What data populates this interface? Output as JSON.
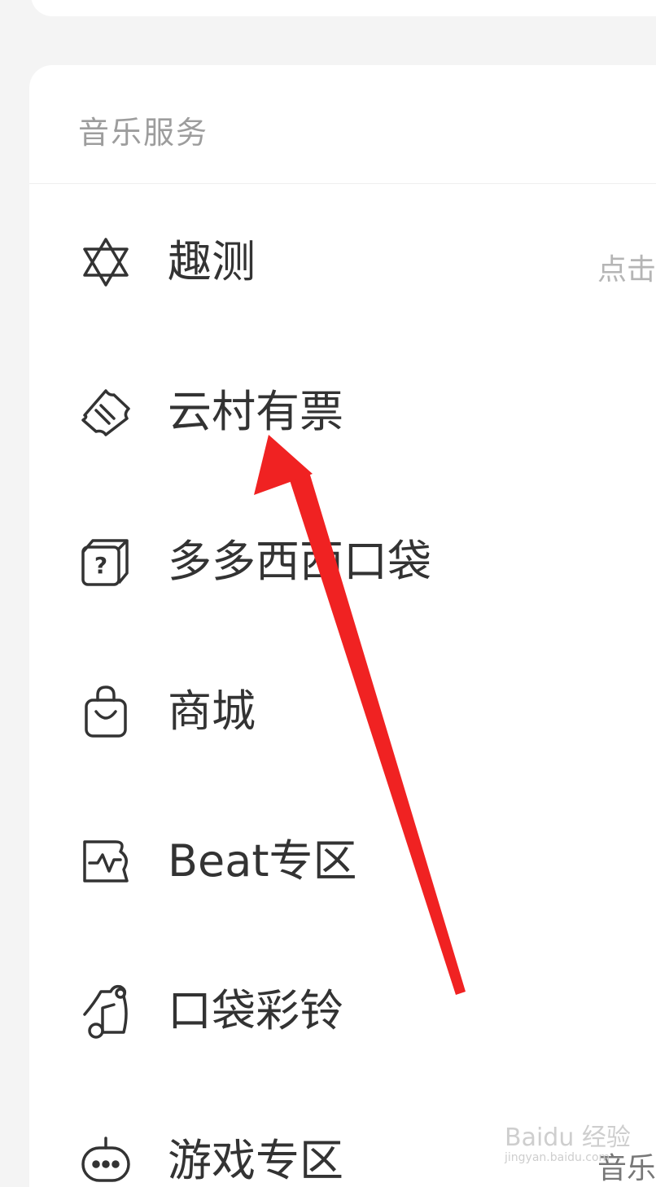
{
  "section": {
    "title": "音乐服务"
  },
  "items": [
    {
      "label": "趣测",
      "icon": "hexagram-star-icon",
      "hint": "点击"
    },
    {
      "label": "云村有票",
      "icon": "ticket-icon",
      "hint": ""
    },
    {
      "label": "多多西西口袋",
      "icon": "mystery-box-icon",
      "hint": ""
    },
    {
      "label": "商城",
      "icon": "shopping-bag-icon",
      "hint": ""
    },
    {
      "label": "Beat专区",
      "icon": "beat-wave-icon",
      "hint": ""
    },
    {
      "label": "口袋彩铃",
      "icon": "ringtone-note-icon",
      "hint": ""
    },
    {
      "label": "游戏专区",
      "icon": "gamepad-icon",
      "hint": "音乐"
    }
  ],
  "annotation": {
    "arrow_color": "#f02222"
  },
  "watermark": {
    "logo_text": "Baidu 经验",
    "sub_text": "jingyan.baidu.com"
  }
}
